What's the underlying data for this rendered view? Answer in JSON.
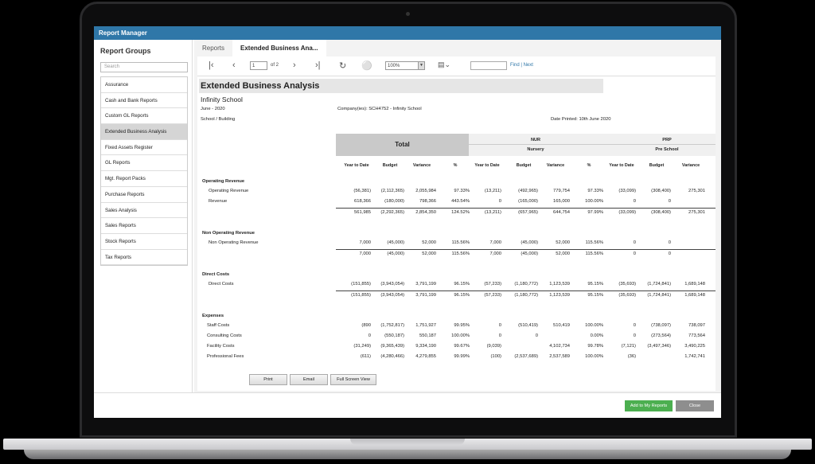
{
  "app": {
    "title": "Report Manager"
  },
  "sidebar": {
    "title": "Report Groups",
    "search_placeholder": "Search",
    "items": [
      {
        "label": "Assurance",
        "active": false
      },
      {
        "label": "Cash and Bank Reports",
        "active": false
      },
      {
        "label": "Custom GL Reports",
        "active": false
      },
      {
        "label": "Extended Business Analysis",
        "active": true
      },
      {
        "label": "Fixed Assets Register",
        "active": false
      },
      {
        "label": "GL Reports",
        "active": false
      },
      {
        "label": "Mgt. Report Packs",
        "active": false
      },
      {
        "label": "Purchase Reports",
        "active": false
      },
      {
        "label": "Sales Analysis",
        "active": false
      },
      {
        "label": "Sales Reports",
        "active": false
      },
      {
        "label": "Stock Reports",
        "active": false
      },
      {
        "label": "Tax Reports",
        "active": false
      }
    ]
  },
  "tabs": [
    {
      "label": "Reports"
    },
    {
      "label": "Extended Business Ana..."
    }
  ],
  "toolbar": {
    "page": "1",
    "of_pages": "of 2",
    "zoom": "100%",
    "find": "Find",
    "sep": "|",
    "next": "Next"
  },
  "report": {
    "title": "Extended Business Analysis",
    "subtitle": "Infinity School",
    "period": "June - 2020",
    "company": "Company(ies): SCH4752 - Infinity School",
    "grouping": "School / Building",
    "date_printed": "Date Printed: 10th June 2020",
    "total_label": "Total",
    "groups": [
      {
        "code": "NUR",
        "name": "Nursery"
      },
      {
        "code": "PRP",
        "name": "Pre School"
      }
    ],
    "column_headers": [
      "Year to Date",
      "Budget",
      "Variance",
      "%",
      "Year to Date",
      "Budget",
      "Variance",
      "%",
      "Year to Date",
      "Budget",
      "Variance"
    ],
    "sections": [
      {
        "title": "Operating Revenue",
        "rows": [
          {
            "label": "Operating Revenue",
            "values": [
              "(56,381)",
              "(2,112,365)",
              "2,055,984",
              "97.33%",
              "(13,211)",
              "(492,965)",
              "779,754",
              "97.33%",
              "(33,099)",
              "(308,400)",
              "275,301"
            ]
          },
          {
            "label": "Revenue",
            "values": [
              "618,366",
              "(180,000)",
              "798,366",
              "443.54%",
              "0",
              "(165,000)",
              "165,000",
              "100.00%",
              "0",
              "0",
              ""
            ]
          }
        ],
        "total": [
          "561,985",
          "(2,292,365)",
          "2,854,350",
          "124.52%",
          "(13,211)",
          "(657,965)",
          "644,754",
          "97.99%",
          "(33,099)",
          "(308,400)",
          "275,301"
        ]
      },
      {
        "title": "Non Operating Revenue",
        "rows": [
          {
            "label": "Non Operating Revenue",
            "values": [
              "7,000",
              "(45,000)",
              "52,000",
              "115.56%",
              "7,000",
              "(45,000)",
              "52,000",
              "115.56%",
              "0",
              "0",
              ""
            ]
          }
        ],
        "total": [
          "7,000",
          "(45,000)",
          "52,000",
          "115.56%",
          "7,000",
          "(45,000)",
          "52,000",
          "115.56%",
          "0",
          "0",
          ""
        ]
      },
      {
        "title": "Direct Costs",
        "rows": [
          {
            "label": "Direct Costs",
            "values": [
              "(151,855)",
              "(3,943,054)",
              "3,791,199",
              "96.15%",
              "(57,233)",
              "(1,180,772)",
              "1,123,539",
              "95.15%",
              "(35,693)",
              "(1,724,841)",
              "1,689,148"
            ]
          }
        ],
        "total": [
          "(151,855)",
          "(3,943,054)",
          "3,791,199",
          "96.15%",
          "(57,233)",
          "(1,180,772)",
          "1,123,539",
          "95.15%",
          "(35,693)",
          "(1,724,841)",
          "1,689,148"
        ]
      },
      {
        "title": "Expenses",
        "rows": [
          {
            "label": "Staff Costs",
            "values": [
              "(890",
              "(1,752,817)",
              "1,751,927",
              "99.95%",
              "0",
              "(510,419)",
              "510,419",
              "100.00%",
              "0",
              "(738,097)",
              "738,097"
            ]
          },
          {
            "label": "Consulting Costs",
            "values": [
              "0",
              "(550,187)",
              "550,187",
              "100.00%",
              "0",
              "0",
              "",
              "0.00%",
              "0",
              "(273,564)",
              "773,564"
            ]
          },
          {
            "label": "Facility Costs",
            "values": [
              "(31,249)",
              "(9,365,439)",
              "9,334,190",
              "99.67%",
              "(9,039)",
              "",
              "4,102,734",
              "99.78%",
              "(7,121)",
              "(3,497,346)",
              "3,490,225"
            ]
          },
          {
            "label": "Professional Fees",
            "values": [
              "(611)",
              "(4,280,466)",
              "4,279,855",
              "99.99%",
              "(100)",
              "(2,537,689)",
              "2,537,589",
              "100.00%",
              "(36)",
              "",
              "1,742,741"
            ]
          }
        ]
      }
    ],
    "buttons": {
      "print": "Print",
      "email": "Email",
      "fullscreen": "Full Screen View"
    }
  },
  "footer": {
    "add_label": "Add to My Reports",
    "close_label": "Close"
  },
  "colors": {
    "titlebar": "#2f77a8",
    "add_button": "#4caf50",
    "close_button": "#8e8e8e"
  }
}
